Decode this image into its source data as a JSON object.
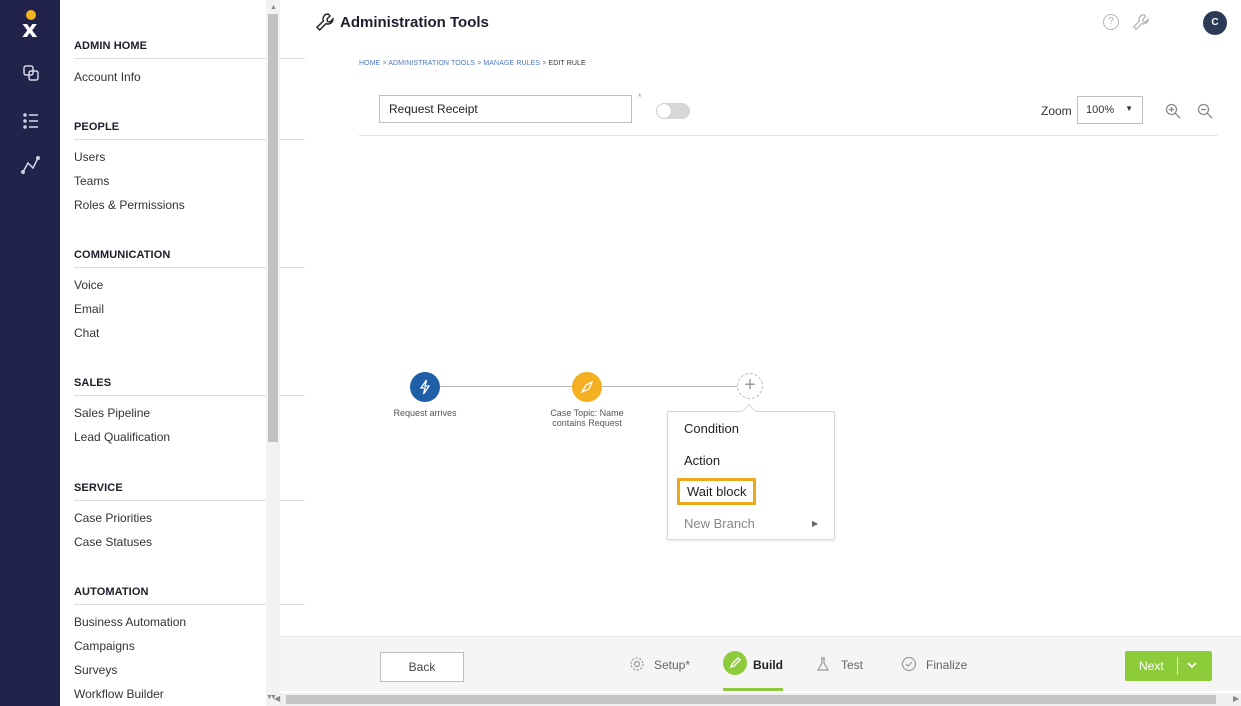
{
  "header": {
    "title": "Administration Tools",
    "avatar_initial": "C",
    "help_glyph": "?"
  },
  "breadcrumb": {
    "path": "HOME > ADMINISTRATION TOOLS > MANAGE RULES > ",
    "current": "EDIT RULE"
  },
  "sidebar": {
    "sections": [
      {
        "title": "ADMIN HOME",
        "items": [
          "Account Info"
        ]
      },
      {
        "title": "PEOPLE",
        "items": [
          "Users",
          "Teams",
          "Roles & Permissions"
        ]
      },
      {
        "title": "COMMUNICATION",
        "items": [
          "Voice",
          "Email",
          "Chat"
        ]
      },
      {
        "title": "SALES",
        "items": [
          "Sales Pipeline",
          "Lead Qualification"
        ]
      },
      {
        "title": "SERVICE",
        "items": [
          "Case Priorities",
          "Case Statuses"
        ]
      },
      {
        "title": "AUTOMATION",
        "items": [
          "Business Automation",
          "Campaigns",
          "Surveys",
          "Workflow Builder"
        ]
      }
    ]
  },
  "editor": {
    "rule_name": "Request Receipt",
    "required_mark": "*",
    "active_toggle": false,
    "zoom_label": "Zoom",
    "zoom_value": "100%"
  },
  "flow": {
    "nodes": [
      {
        "label": "Request arrives",
        "type": "trigger",
        "color": "#1e5fa8"
      },
      {
        "label": "Case Topic: Name contains Request",
        "type": "condition",
        "color": "#f4b021"
      }
    ],
    "add_glyph": "+"
  },
  "menu": {
    "items": [
      "Condition",
      "Action",
      "Wait block",
      "New Branch"
    ],
    "highlighted": "Wait block"
  },
  "bottom": {
    "back_label": "Back",
    "steps": [
      "Setup*",
      "Build",
      "Test",
      "Finalize"
    ],
    "active_step": "Build",
    "next_label": "Next"
  },
  "colors": {
    "rail": "#21234a",
    "accent_green": "#8ccb39",
    "highlight_orange": "#eba91b",
    "link_blue": "#4a78c9"
  }
}
